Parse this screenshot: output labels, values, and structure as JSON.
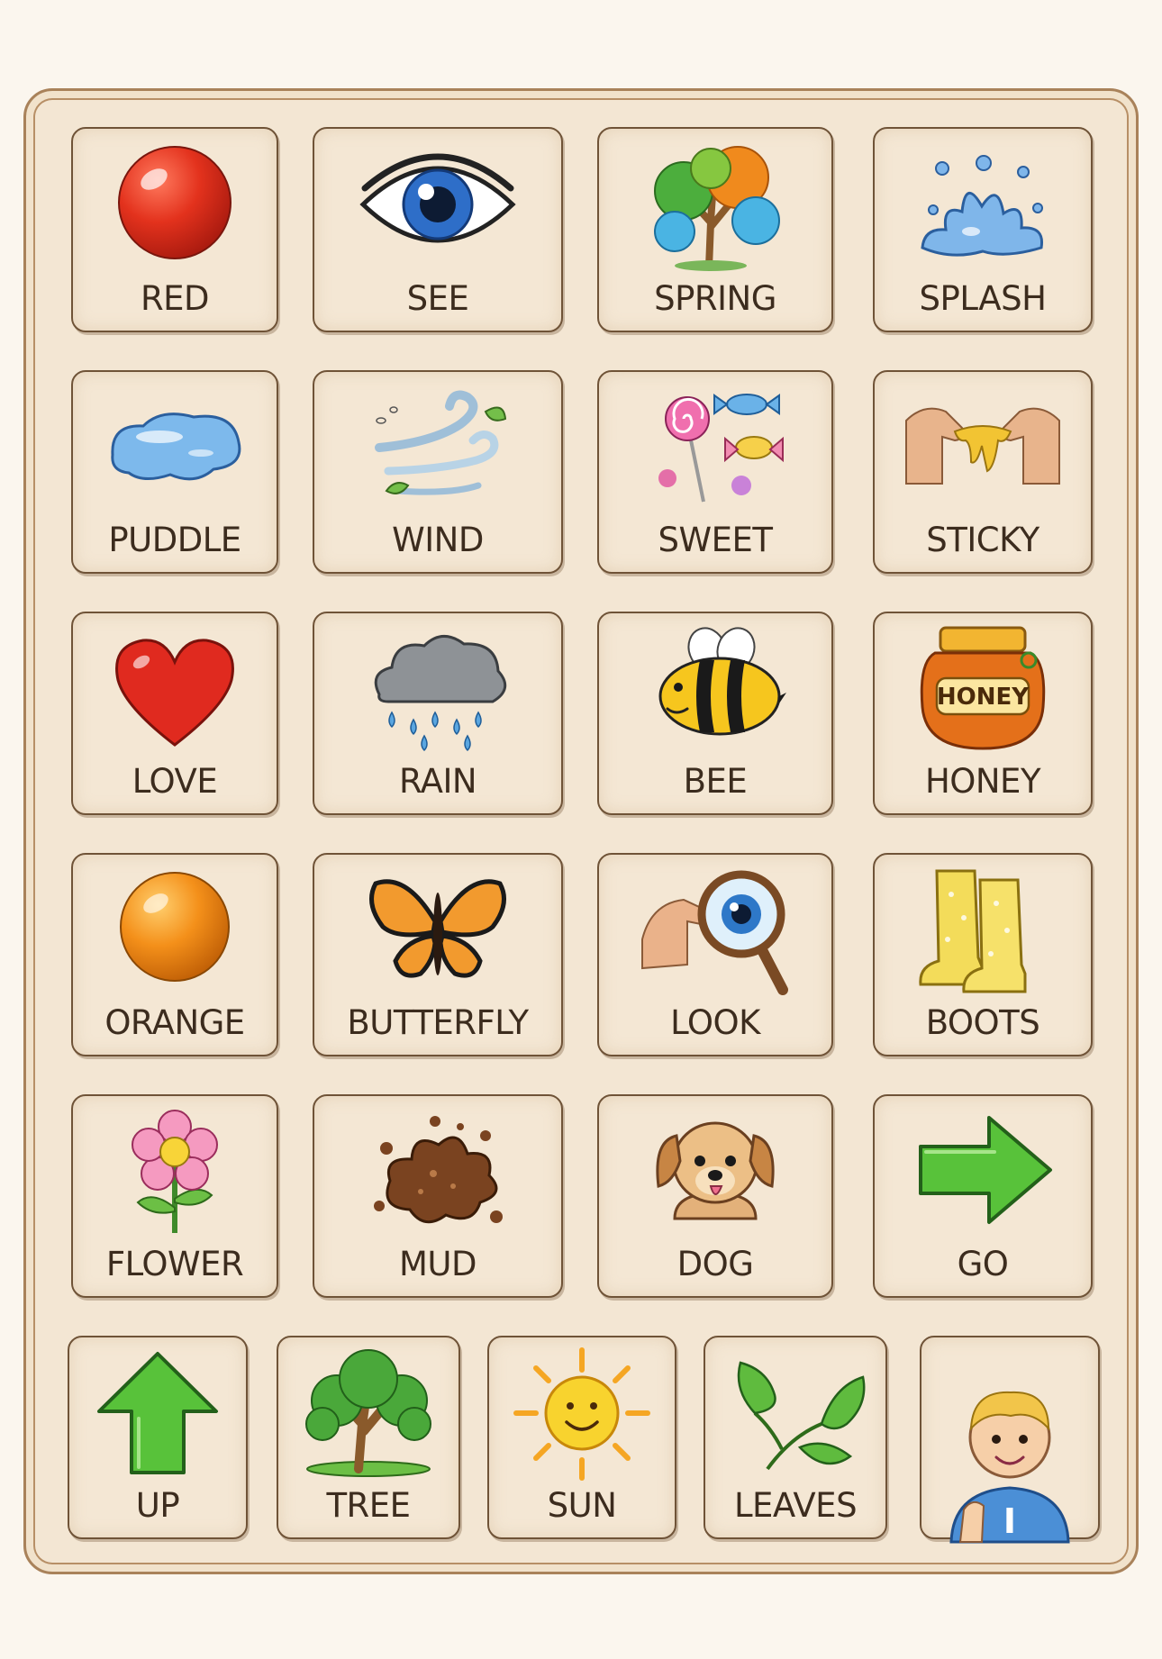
{
  "cards": [
    {
      "label": "RED",
      "icon": "red-ball-icon"
    },
    {
      "label": "SEE",
      "icon": "eye-icon"
    },
    {
      "label": "SPRING",
      "icon": "blossom-tree-icon"
    },
    {
      "label": "SPLASH",
      "icon": "water-splash-icon"
    },
    {
      "label": "PUDDLE",
      "icon": "puddle-icon"
    },
    {
      "label": "WIND",
      "icon": "wind-icon"
    },
    {
      "label": "SWEET",
      "icon": "candy-icon"
    },
    {
      "label": "STICKY",
      "icon": "sticky-hands-icon"
    },
    {
      "label": "LOVE",
      "icon": "heart-icon"
    },
    {
      "label": "RAIN",
      "icon": "rain-cloud-icon"
    },
    {
      "label": "BEE",
      "icon": "bee-icon"
    },
    {
      "label": "HONEY",
      "icon": "honey-jar-icon",
      "jar_text": "HONEY"
    },
    {
      "label": "ORANGE",
      "icon": "orange-ball-icon"
    },
    {
      "label": "BUTTERFLY",
      "icon": "butterfly-icon"
    },
    {
      "label": "LOOK",
      "icon": "magnifying-glass-icon"
    },
    {
      "label": "BOOTS",
      "icon": "rain-boots-icon"
    },
    {
      "label": "FLOWER",
      "icon": "flower-icon"
    },
    {
      "label": "MUD",
      "icon": "mud-splat-icon"
    },
    {
      "label": "DOG",
      "icon": "dog-icon"
    },
    {
      "label": "GO",
      "icon": "right-arrow-icon"
    },
    {
      "label": "UP",
      "icon": "up-arrow-icon"
    },
    {
      "label": "TREE",
      "icon": "tree-icon"
    },
    {
      "label": "SUN",
      "icon": "sun-icon"
    },
    {
      "label": "LEAVES",
      "icon": "leaves-icon"
    },
    {
      "label": "I",
      "icon": "boy-pointing-self-icon",
      "shirt_text": "I"
    }
  ],
  "colors": {
    "card_bg": "#f4e7d4",
    "card_border": "#6f5337",
    "label_text": "#3c2c1e",
    "board_border": "#a9825a"
  }
}
